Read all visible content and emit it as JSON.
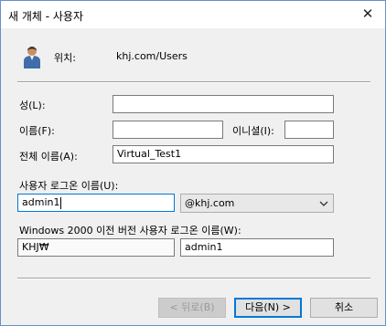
{
  "window": {
    "title": "새 개체 - 사용자",
    "close_icon": "close-icon"
  },
  "location": {
    "label": "위치:",
    "value": "khj.com/Users"
  },
  "fields": {
    "last_name": {
      "label": "성(L):",
      "value": ""
    },
    "first_name": {
      "label": "이름(F):",
      "value": ""
    },
    "initials": {
      "label": "이니셜(I):",
      "value": ""
    },
    "full_name": {
      "label": "전체 이름(A):",
      "value": "Virtual_Test1"
    },
    "logon_name": {
      "label": "사용자 로그온 이름(U):",
      "value": "admin1"
    },
    "domain": {
      "selected": "@khj.com"
    },
    "pre2000": {
      "label": "Windows 2000 이전 버전 사용자 로그온 이름(W):",
      "domain_value": "KHJ₩",
      "user_value": "admin1"
    }
  },
  "buttons": {
    "back": "< 뒤로(B)",
    "next": "다음(N) >",
    "cancel": "취소"
  },
  "colors": {
    "focus_border": "#0078d7",
    "dialog_bg": "#f0f0f0",
    "window_border": "#6a8fc7"
  }
}
